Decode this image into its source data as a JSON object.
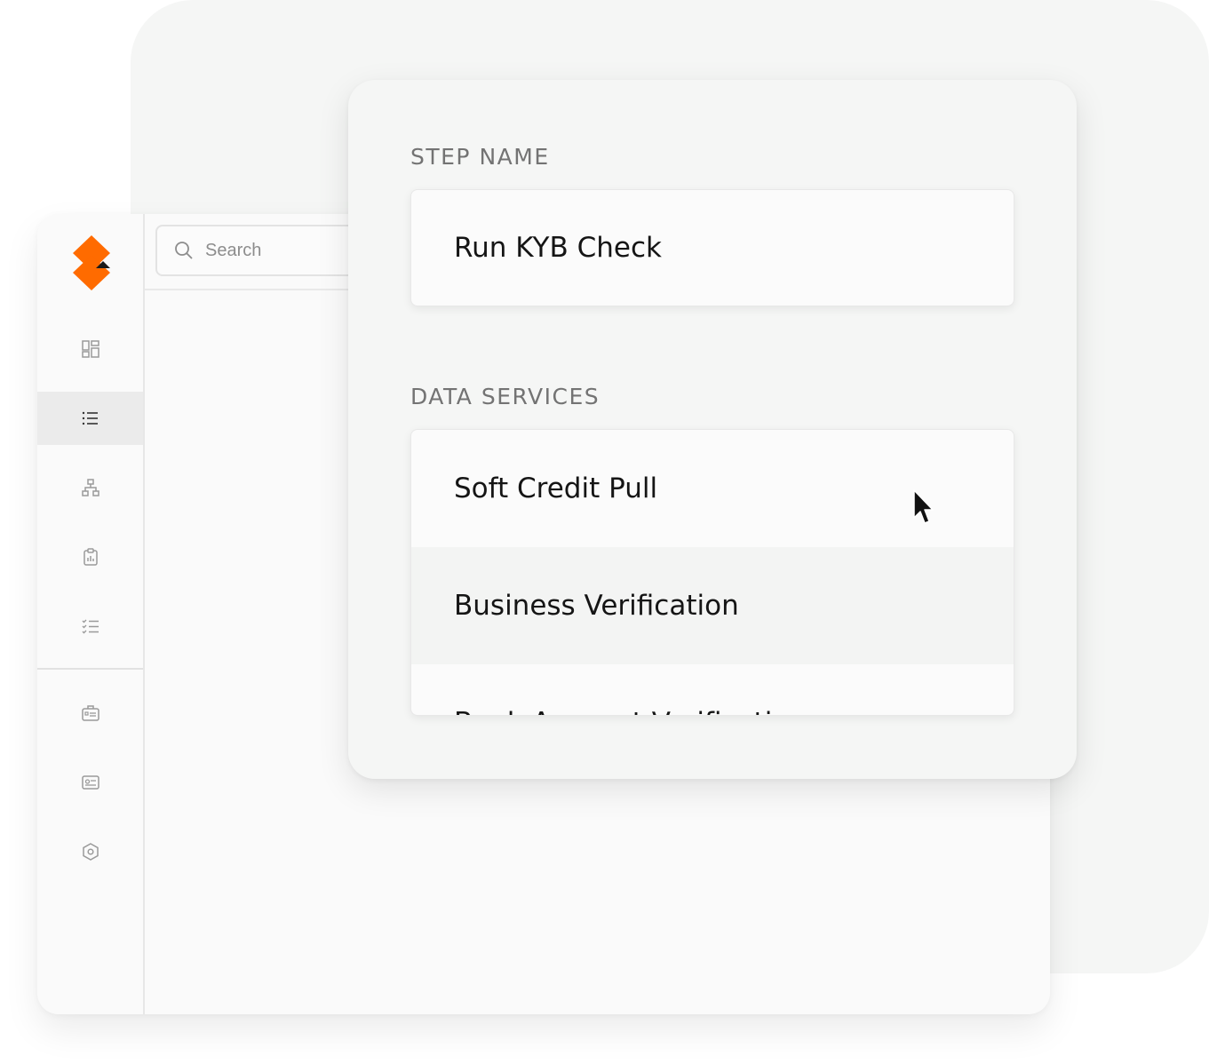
{
  "search": {
    "placeholder": "Search"
  },
  "sidebar": {
    "items": [
      {
        "icon": "dashboard-icon",
        "active": false
      },
      {
        "icon": "list-icon",
        "active": true
      },
      {
        "icon": "hierarchy-icon",
        "active": false
      },
      {
        "icon": "clipboard-chart-icon",
        "active": false
      },
      {
        "icon": "checklist-icon",
        "active": false
      },
      {
        "icon": "briefcase-icon",
        "active": false
      },
      {
        "icon": "id-card-icon",
        "active": false
      },
      {
        "icon": "settings-hex-icon",
        "active": false
      }
    ]
  },
  "panel": {
    "step_name_label": "STEP NAME",
    "step_name_value": "Run KYB Check",
    "data_services_label": "DATA SERVICES",
    "services": [
      "Soft Credit Pull",
      "Business Verification",
      "Bank Account Verification"
    ]
  },
  "colors": {
    "brand_orange": "#ff6b00",
    "brand_dark": "#1a1a1a",
    "icon_gray": "#9a9a9a",
    "label_gray": "#737373"
  }
}
